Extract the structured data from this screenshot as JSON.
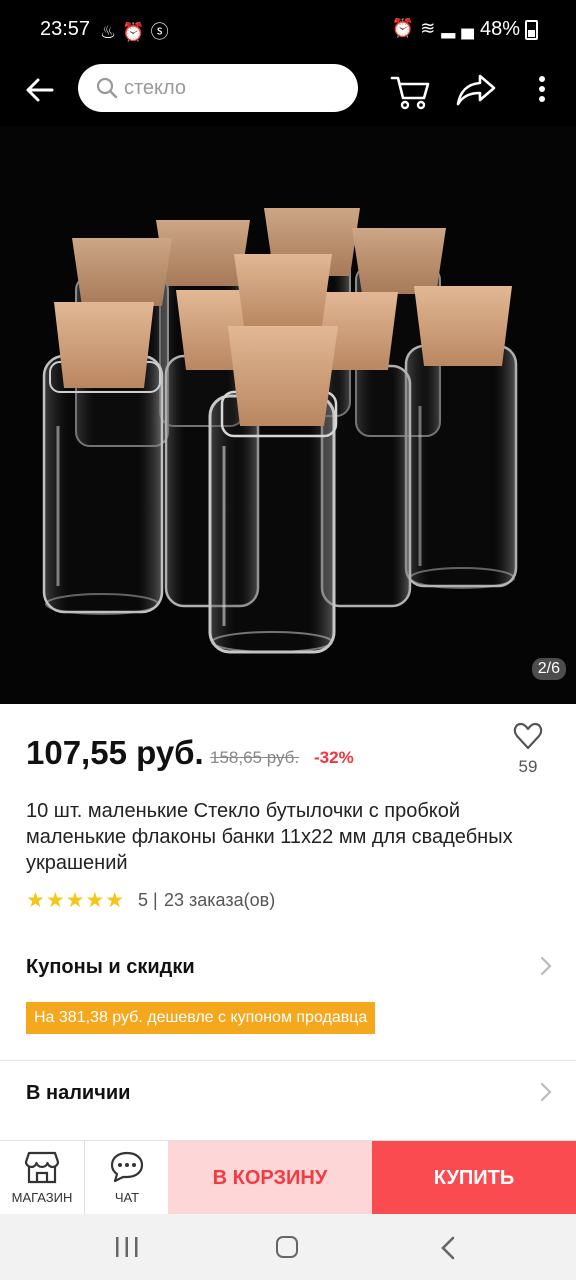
{
  "status_bar": {
    "time": "23:57",
    "left_icons": [
      "notification-icon",
      "alarm-icon",
      "shazam-icon"
    ],
    "right_icons": [
      "alarm-icon",
      "wifi-icon",
      "signal-icon"
    ],
    "battery": "48%"
  },
  "top_bar": {
    "search_placeholder": "стекло",
    "icons": [
      "back-arrow-icon",
      "search-icon",
      "cart-icon",
      "share-icon",
      "more-vert-icon"
    ]
  },
  "gallery": {
    "page_indicator": "2/6",
    "current_page": 2,
    "total_pages": 6
  },
  "product": {
    "price": "107,55 руб.",
    "old_price": "158,65 руб.",
    "discount": "-32%",
    "wishlist_count": "59",
    "title": "10 шт. маленькие Стекло бутылочки с пробкой маленькие флаконы банки 11х22 мм для свадебных украшений",
    "rating_value": "5",
    "stars": 5,
    "rating_separator": "|",
    "orders": "23 заказа(ов)"
  },
  "coupons": {
    "title": "Купоны и скидки",
    "tag": "На 381,38 руб. дешевле с купоном продавца"
  },
  "stock": {
    "title": "В наличии"
  },
  "bottom_bar": {
    "store_label": "МАГАЗИН",
    "chat_label": "ЧАТ",
    "add_to_cart": "В КОРЗИНУ",
    "buy": "КУПИТЬ"
  },
  "colors": {
    "accent_red": "#f5333f",
    "buy_bg": "#fa4b50",
    "cart_bg": "#fdd7d8",
    "coupon_tag": "#f5a81e",
    "stars": "#f5c518"
  }
}
